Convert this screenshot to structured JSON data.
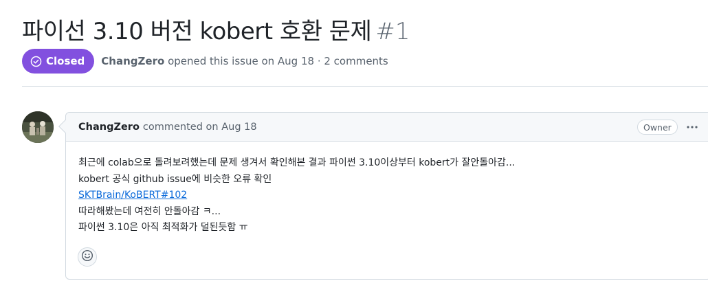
{
  "issue": {
    "title": "파이선 3.10 버전 kobert 호환 문제",
    "number": "#1",
    "state": "Closed",
    "author": "ChangZero",
    "meta_text": "opened this issue on Aug 18 · 2 comments"
  },
  "comment": {
    "author": "ChangZero",
    "meta_text": "commented on Aug 18",
    "role_badge": "Owner",
    "body": {
      "line1": "최근에 colab으로 돌려보려했는데 문제 생겨서 확인해본 결과 파이썬 3.10이상부터 kobert가 잘안돌아감...",
      "line2": "kobert 공식 github issue에 비슷한 오류 확인",
      "link": "SKTBrain/KoBERT#102",
      "line3": "따라해봤는데 여전히 안돌아감 ㅋ...",
      "line4": "파이썬 3.10은 아직 최적화가 덜된듯함 ㅠ"
    }
  },
  "colors": {
    "closed_purple": "#8250df",
    "link_blue": "#0969da",
    "muted_text": "#59636e",
    "border": "#d1d9e0",
    "header_bg": "#f6f8fa"
  },
  "icons": {
    "state": "check-circle-icon",
    "more": "kebab-horizontal-icon",
    "reaction": "smiley-icon"
  }
}
